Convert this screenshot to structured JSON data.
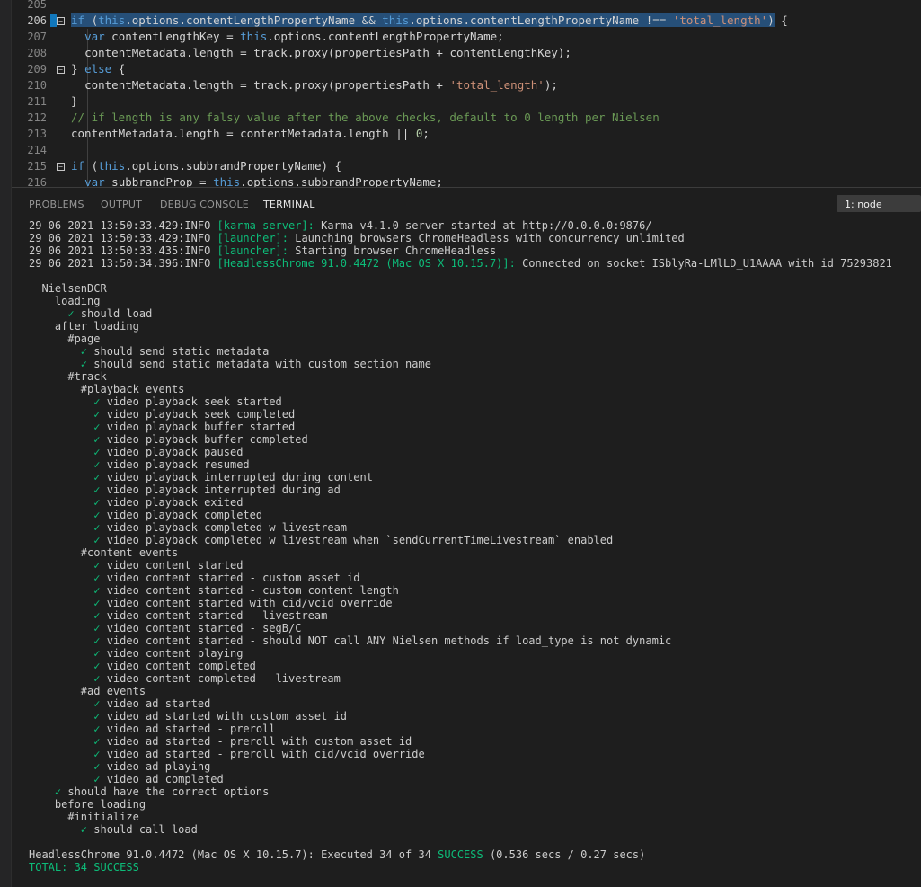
{
  "editor": {
    "lines": [
      {
        "n": "205",
        "indent": "",
        "tokens": []
      },
      {
        "n": "206",
        "current": true,
        "fold": true,
        "indent": "",
        "selected": true,
        "tokens": [
          {
            "t": "kw",
            "v": "if"
          },
          {
            "t": "",
            "v": " ("
          },
          {
            "t": "kw",
            "v": "this"
          },
          {
            "t": "",
            "v": ".options.contentLengthPropertyName && "
          },
          {
            "t": "kw",
            "v": "this"
          },
          {
            "t": "",
            "v": ".options.contentLengthPropertyName !== "
          },
          {
            "t": "str",
            "v": "'total_length'"
          },
          {
            "t": "",
            "v": ")"
          }
        ],
        "after": " {"
      },
      {
        "n": "207",
        "indent": "  ",
        "tokens": [
          {
            "t": "kw",
            "v": "var"
          },
          {
            "t": "",
            "v": " contentLengthKey = "
          },
          {
            "t": "kw",
            "v": "this"
          },
          {
            "t": "",
            "v": ".options.contentLengthPropertyName;"
          }
        ]
      },
      {
        "n": "208",
        "indent": "  ",
        "tokens": [
          {
            "t": "",
            "v": "contentMetadata.length = track.proxy(propertiesPath + contentLengthKey);"
          }
        ]
      },
      {
        "n": "209",
        "fold": true,
        "indent": "",
        "tokens": [
          {
            "t": "",
            "v": "} "
          },
          {
            "t": "kw",
            "v": "else"
          },
          {
            "t": "",
            "v": " {"
          }
        ]
      },
      {
        "n": "210",
        "indent": "  ",
        "tokens": [
          {
            "t": "",
            "v": "contentMetadata.length = track.proxy(propertiesPath + "
          },
          {
            "t": "str",
            "v": "'total_length'"
          },
          {
            "t": "",
            "v": ");"
          }
        ]
      },
      {
        "n": "211",
        "indent": "",
        "tokens": [
          {
            "t": "",
            "v": "}"
          }
        ]
      },
      {
        "n": "212",
        "indent": "",
        "tokens": [
          {
            "t": "cmt",
            "v": "// if length is any falsy value after the above checks, default to 0 length per Nielsen"
          }
        ]
      },
      {
        "n": "213",
        "indent": "",
        "tokens": [
          {
            "t": "",
            "v": "contentMetadata.length = contentMetadata.length || "
          },
          {
            "t": "num",
            "v": "0"
          },
          {
            "t": "",
            "v": ";"
          }
        ]
      },
      {
        "n": "214",
        "indent": "",
        "tokens": []
      },
      {
        "n": "215",
        "fold": true,
        "indent": "",
        "tokens": [
          {
            "t": "kw",
            "v": "if"
          },
          {
            "t": "",
            "v": " ("
          },
          {
            "t": "kw",
            "v": "this"
          },
          {
            "t": "",
            "v": ".options.subbrandPropertyName) {"
          }
        ]
      },
      {
        "n": "216",
        "indent": "  ",
        "tokens": [
          {
            "t": "kw",
            "v": "var"
          },
          {
            "t": "",
            "v": " subbrandProp = "
          },
          {
            "t": "kw",
            "v": "this"
          },
          {
            "t": "",
            "v": ".options.subbrandPropertyName;"
          }
        ]
      }
    ]
  },
  "panel": {
    "tabs": [
      {
        "label": "PROBLEMS",
        "name": "tab-problems"
      },
      {
        "label": "OUTPUT",
        "name": "tab-output"
      },
      {
        "label": "DEBUG CONSOLE",
        "name": "tab-debug-console"
      },
      {
        "label": "TERMINAL",
        "name": "tab-terminal",
        "active": true
      }
    ],
    "terminal_selector": "1: node"
  },
  "terminal": {
    "lines": [
      {
        "parts": [
          {
            "v": "29 06 2021 13:50:33.429:INFO "
          },
          {
            "c": "green",
            "v": "[karma-server]:"
          },
          {
            "v": " Karma v4.1.0 server started at http://0.0.0.0:9876/"
          }
        ]
      },
      {
        "parts": [
          {
            "v": "29 06 2021 13:50:33.429:INFO "
          },
          {
            "c": "green",
            "v": "[launcher]:"
          },
          {
            "v": " Launching browsers ChromeHeadless with concurrency unlimited"
          }
        ]
      },
      {
        "parts": [
          {
            "v": "29 06 2021 13:50:33.435:INFO "
          },
          {
            "c": "green",
            "v": "[launcher]:"
          },
          {
            "v": " Starting browser ChromeHeadless"
          }
        ]
      },
      {
        "parts": [
          {
            "v": "29 06 2021 13:50:34.396:INFO "
          },
          {
            "c": "green",
            "v": "[HeadlessChrome 91.0.4472 (Mac OS X 10.15.7)]:"
          },
          {
            "v": " Connected on socket ISblyRa-LMlLD_U1AAAA with id 75293821"
          }
        ]
      },
      {
        "parts": []
      },
      {
        "parts": [
          {
            "v": "  NielsenDCR"
          }
        ]
      },
      {
        "parts": [
          {
            "v": "    loading"
          }
        ]
      },
      {
        "parts": [
          {
            "v": "      "
          },
          {
            "c": "check",
            "v": "✓"
          },
          {
            "v": " should load"
          }
        ]
      },
      {
        "parts": [
          {
            "v": "    after loading"
          }
        ]
      },
      {
        "parts": [
          {
            "v": "      #page"
          }
        ]
      },
      {
        "parts": [
          {
            "v": "        "
          },
          {
            "c": "check",
            "v": "✓"
          },
          {
            "v": " should send static metadata"
          }
        ]
      },
      {
        "parts": [
          {
            "v": "        "
          },
          {
            "c": "check",
            "v": "✓"
          },
          {
            "v": " should send static metadata with custom section name"
          }
        ]
      },
      {
        "parts": [
          {
            "v": "      #track"
          }
        ]
      },
      {
        "parts": [
          {
            "v": "        #playback events"
          }
        ]
      },
      {
        "parts": [
          {
            "v": "          "
          },
          {
            "c": "check",
            "v": "✓"
          },
          {
            "v": " video playback seek started"
          }
        ]
      },
      {
        "parts": [
          {
            "v": "          "
          },
          {
            "c": "check",
            "v": "✓"
          },
          {
            "v": " video playback seek completed"
          }
        ]
      },
      {
        "parts": [
          {
            "v": "          "
          },
          {
            "c": "check",
            "v": "✓"
          },
          {
            "v": " video playback buffer started"
          }
        ]
      },
      {
        "parts": [
          {
            "v": "          "
          },
          {
            "c": "check",
            "v": "✓"
          },
          {
            "v": " video playback buffer completed"
          }
        ]
      },
      {
        "parts": [
          {
            "v": "          "
          },
          {
            "c": "check",
            "v": "✓"
          },
          {
            "v": " video playback paused"
          }
        ]
      },
      {
        "parts": [
          {
            "v": "          "
          },
          {
            "c": "check",
            "v": "✓"
          },
          {
            "v": " video playback resumed"
          }
        ]
      },
      {
        "parts": [
          {
            "v": "          "
          },
          {
            "c": "check",
            "v": "✓"
          },
          {
            "v": " video playback interrupted during content"
          }
        ]
      },
      {
        "parts": [
          {
            "v": "          "
          },
          {
            "c": "check",
            "v": "✓"
          },
          {
            "v": " video playback interrupted during ad"
          }
        ]
      },
      {
        "parts": [
          {
            "v": "          "
          },
          {
            "c": "check",
            "v": "✓"
          },
          {
            "v": " video playback exited"
          }
        ]
      },
      {
        "parts": [
          {
            "v": "          "
          },
          {
            "c": "check",
            "v": "✓"
          },
          {
            "v": " video playback completed"
          }
        ]
      },
      {
        "parts": [
          {
            "v": "          "
          },
          {
            "c": "check",
            "v": "✓"
          },
          {
            "v": " video playback completed w livestream"
          }
        ]
      },
      {
        "parts": [
          {
            "v": "          "
          },
          {
            "c": "check",
            "v": "✓"
          },
          {
            "v": " video playback completed w livestream when `sendCurrentTimeLivestream` enabled"
          }
        ]
      },
      {
        "parts": [
          {
            "v": "        #content events"
          }
        ]
      },
      {
        "parts": [
          {
            "v": "          "
          },
          {
            "c": "check",
            "v": "✓"
          },
          {
            "v": " video content started"
          }
        ]
      },
      {
        "parts": [
          {
            "v": "          "
          },
          {
            "c": "check",
            "v": "✓"
          },
          {
            "v": " video content started - custom asset id"
          }
        ]
      },
      {
        "parts": [
          {
            "v": "          "
          },
          {
            "c": "check",
            "v": "✓"
          },
          {
            "v": " video content started - custom content length"
          }
        ]
      },
      {
        "parts": [
          {
            "v": "          "
          },
          {
            "c": "check",
            "v": "✓"
          },
          {
            "v": " video content started with cid/vcid override"
          }
        ]
      },
      {
        "parts": [
          {
            "v": "          "
          },
          {
            "c": "check",
            "v": "✓"
          },
          {
            "v": " video content started - livestream"
          }
        ]
      },
      {
        "parts": [
          {
            "v": "          "
          },
          {
            "c": "check",
            "v": "✓"
          },
          {
            "v": " video content started - segB/C"
          }
        ]
      },
      {
        "parts": [
          {
            "v": "          "
          },
          {
            "c": "check",
            "v": "✓"
          },
          {
            "v": " video content started - should NOT call ANY Nielsen methods if load_type is not dynamic"
          }
        ]
      },
      {
        "parts": [
          {
            "v": "          "
          },
          {
            "c": "check",
            "v": "✓"
          },
          {
            "v": " video content playing"
          }
        ]
      },
      {
        "parts": [
          {
            "v": "          "
          },
          {
            "c": "check",
            "v": "✓"
          },
          {
            "v": " video content completed"
          }
        ]
      },
      {
        "parts": [
          {
            "v": "          "
          },
          {
            "c": "check",
            "v": "✓"
          },
          {
            "v": " video content completed - livestream"
          }
        ]
      },
      {
        "parts": [
          {
            "v": "        #ad events"
          }
        ]
      },
      {
        "parts": [
          {
            "v": "          "
          },
          {
            "c": "check",
            "v": "✓"
          },
          {
            "v": " video ad started"
          }
        ]
      },
      {
        "parts": [
          {
            "v": "          "
          },
          {
            "c": "check",
            "v": "✓"
          },
          {
            "v": " video ad started with custom asset id"
          }
        ]
      },
      {
        "parts": [
          {
            "v": "          "
          },
          {
            "c": "check",
            "v": "✓"
          },
          {
            "v": " video ad started - preroll"
          }
        ]
      },
      {
        "parts": [
          {
            "v": "          "
          },
          {
            "c": "check",
            "v": "✓"
          },
          {
            "v": " video ad started - preroll with custom asset id"
          }
        ]
      },
      {
        "parts": [
          {
            "v": "          "
          },
          {
            "c": "check",
            "v": "✓"
          },
          {
            "v": " video ad started - preroll with cid/vcid override"
          }
        ]
      },
      {
        "parts": [
          {
            "v": "          "
          },
          {
            "c": "check",
            "v": "✓"
          },
          {
            "v": " video ad playing"
          }
        ]
      },
      {
        "parts": [
          {
            "v": "          "
          },
          {
            "c": "check",
            "v": "✓"
          },
          {
            "v": " video ad completed"
          }
        ]
      },
      {
        "parts": [
          {
            "v": "    "
          },
          {
            "c": "check",
            "v": "✓"
          },
          {
            "v": " should have the correct options"
          }
        ]
      },
      {
        "parts": [
          {
            "v": "    before loading"
          }
        ]
      },
      {
        "parts": [
          {
            "v": "      #initialize"
          }
        ]
      },
      {
        "parts": [
          {
            "v": "        "
          },
          {
            "c": "check",
            "v": "✓"
          },
          {
            "v": " should call load"
          }
        ]
      },
      {
        "parts": []
      },
      {
        "parts": [
          {
            "v": "HeadlessChrome 91.0.4472 (Mac OS X 10.15.7): Executed 34 of 34 "
          },
          {
            "c": "green",
            "v": "SUCCESS"
          },
          {
            "v": " (0.536 secs / 0.27 secs)"
          }
        ]
      },
      {
        "parts": [
          {
            "c": "green",
            "v": "TOTAL: 34 SUCCESS"
          }
        ]
      }
    ]
  },
  "colors": {
    "background": "#1e1e1e",
    "keyword": "#569cd6",
    "string": "#ce9178",
    "comment": "#6a9955",
    "success": "#0dbc79",
    "selection": "#264f78"
  }
}
